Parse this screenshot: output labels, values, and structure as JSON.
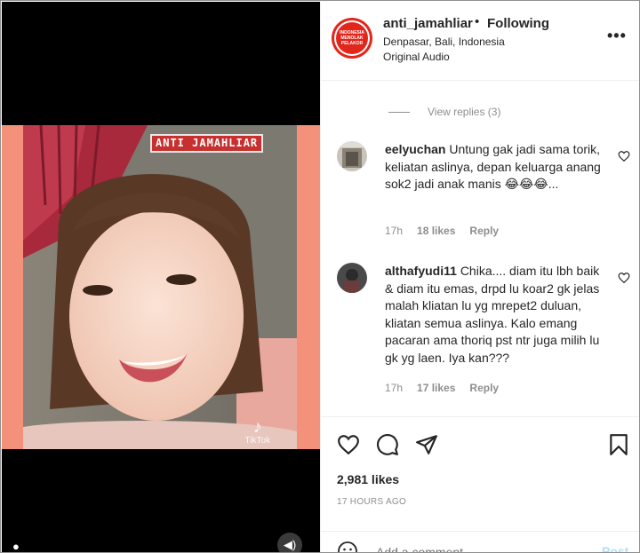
{
  "media": {
    "watermark_text": "ANTI JAMAHLIAR",
    "tiktok_label": "TikTok",
    "sound_icon": "speaker-icon",
    "background_color": "#f4917a"
  },
  "header": {
    "avatar_text": [
      "INDONESIA",
      "MENOLAK",
      "PELAKOR"
    ],
    "username": "anti_jamahliar",
    "separator": "•",
    "follow_label": "Following",
    "location": "Denpasar, Bali, Indonesia",
    "audio": "Original Audio",
    "more_label": "•••"
  },
  "comments": {
    "view_replies": "View replies (3)",
    "items": [
      {
        "username": "eelyuchan",
        "text": "Untung gak jadi sama torik, keliatan aslinya, depan keluarga anang sok2 jadi anak manis 😂😂😂...",
        "time": "17h",
        "likes": "18 likes",
        "reply": "Reply"
      },
      {
        "username": "althafyudi11",
        "text": "Chika.... diam itu lbh baik & diam itu emas, drpd lu koar2 gk jelas malah kliatan lu yg mrepet2 duluan, kliatan semua aslinya. Kalo emang pacaran ama thoriq pst ntr juga milih lu gk yg laen. Iya kan???",
        "time": "17h",
        "likes": "17 likes",
        "reply": "Reply"
      }
    ]
  },
  "actions": {
    "likes": "2,981 likes",
    "time": "17 HOURS AGO",
    "comment_placeholder": "Add a comment...",
    "post_label": "Post"
  }
}
